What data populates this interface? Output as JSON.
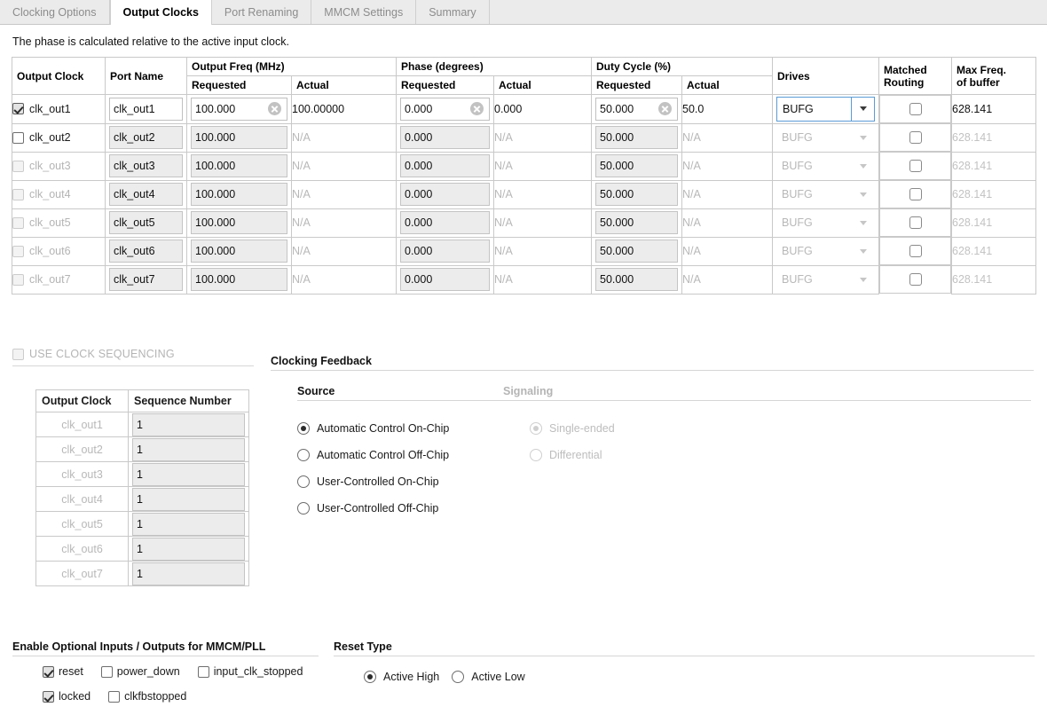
{
  "tabs": [
    {
      "label": "Clocking Options",
      "active": false
    },
    {
      "label": "Output Clocks",
      "active": true
    },
    {
      "label": "Port Renaming",
      "active": false
    },
    {
      "label": "MMCM Settings",
      "active": false
    },
    {
      "label": "Summary",
      "active": false
    }
  ],
  "note": "The phase is calculated relative to the active input clock.",
  "clocks_table": {
    "group_headers": {
      "output_clock": "Output Clock",
      "port_name": "Port Name",
      "output_freq": "Output Freq (MHz)",
      "phase": "Phase (degrees)",
      "duty_cycle": "Duty Cycle (%)",
      "drives": "Drives",
      "matched_routing_line1": "Matched",
      "matched_routing_line2": "Routing",
      "max_freq_line1": "Max Freq.",
      "max_freq_line2": "of buffer"
    },
    "sub_headers": {
      "requested": "Requested",
      "actual": "Actual"
    },
    "na_text": "N/A",
    "rows": [
      {
        "name": "clk_out1",
        "checked": true,
        "enabled": true,
        "port_name": "clk_out1",
        "freq_requested": "100.000",
        "freq_actual": "100.00000",
        "phase_requested": "0.000",
        "phase_actual": "0.000",
        "duty_requested": "50.000",
        "duty_actual": "50.0",
        "drives": "BUFG",
        "matched_routing": false,
        "max_freq": "628.141"
      },
      {
        "name": "clk_out2",
        "checked": false,
        "enabled": true,
        "port_name": "clk_out2",
        "freq_requested": "100.000",
        "freq_actual": "N/A",
        "phase_requested": "0.000",
        "phase_actual": "N/A",
        "duty_requested": "50.000",
        "duty_actual": "N/A",
        "drives": "BUFG",
        "matched_routing": false,
        "max_freq": "628.141"
      },
      {
        "name": "clk_out3",
        "checked": false,
        "enabled": false,
        "port_name": "clk_out3",
        "freq_requested": "100.000",
        "freq_actual": "N/A",
        "phase_requested": "0.000",
        "phase_actual": "N/A",
        "duty_requested": "50.000",
        "duty_actual": "N/A",
        "drives": "BUFG",
        "matched_routing": false,
        "max_freq": "628.141"
      },
      {
        "name": "clk_out4",
        "checked": false,
        "enabled": false,
        "port_name": "clk_out4",
        "freq_requested": "100.000",
        "freq_actual": "N/A",
        "phase_requested": "0.000",
        "phase_actual": "N/A",
        "duty_requested": "50.000",
        "duty_actual": "N/A",
        "drives": "BUFG",
        "matched_routing": false,
        "max_freq": "628.141"
      },
      {
        "name": "clk_out5",
        "checked": false,
        "enabled": false,
        "port_name": "clk_out5",
        "freq_requested": "100.000",
        "freq_actual": "N/A",
        "phase_requested": "0.000",
        "phase_actual": "N/A",
        "duty_requested": "50.000",
        "duty_actual": "N/A",
        "drives": "BUFG",
        "matched_routing": false,
        "max_freq": "628.141"
      },
      {
        "name": "clk_out6",
        "checked": false,
        "enabled": false,
        "port_name": "clk_out6",
        "freq_requested": "100.000",
        "freq_actual": "N/A",
        "phase_requested": "0.000",
        "phase_actual": "N/A",
        "duty_requested": "50.000",
        "duty_actual": "N/A",
        "drives": "BUFG",
        "matched_routing": false,
        "max_freq": "628.141"
      },
      {
        "name": "clk_out7",
        "checked": false,
        "enabled": false,
        "port_name": "clk_out7",
        "freq_requested": "100.000",
        "freq_actual": "N/A",
        "phase_requested": "0.000",
        "phase_actual": "N/A",
        "duty_requested": "50.000",
        "duty_actual": "N/A",
        "drives": "BUFG",
        "matched_routing": false,
        "max_freq": "628.141"
      }
    ]
  },
  "sequencing": {
    "toggle_label": "USE CLOCK SEQUENCING",
    "toggle_checked": false,
    "toggle_enabled": false,
    "headers": {
      "clock": "Output Clock",
      "sequence": "Sequence Number"
    },
    "rows": [
      {
        "clock": "clk_out1",
        "sequence": "1"
      },
      {
        "clock": "clk_out2",
        "sequence": "1"
      },
      {
        "clock": "clk_out3",
        "sequence": "1"
      },
      {
        "clock": "clk_out4",
        "sequence": "1"
      },
      {
        "clock": "clk_out5",
        "sequence": "1"
      },
      {
        "clock": "clk_out6",
        "sequence": "1"
      },
      {
        "clock": "clk_out7",
        "sequence": "1"
      }
    ]
  },
  "clocking_feedback": {
    "title": "Clocking Feedback",
    "source": {
      "title": "Source",
      "options": [
        {
          "label": "Automatic Control On-Chip",
          "selected": true,
          "enabled": true
        },
        {
          "label": "Automatic Control Off-Chip",
          "selected": false,
          "enabled": true
        },
        {
          "label": "User-Controlled On-Chip",
          "selected": false,
          "enabled": true
        },
        {
          "label": "User-Controlled Off-Chip",
          "selected": false,
          "enabled": true
        }
      ]
    },
    "signaling": {
      "title": "Signaling",
      "options": [
        {
          "label": "Single-ended",
          "selected": true,
          "enabled": false
        },
        {
          "label": "Differential",
          "selected": false,
          "enabled": false
        }
      ]
    }
  },
  "optional_io": {
    "title": "Enable Optional Inputs / Outputs for MMCM/PLL",
    "row1": [
      {
        "label": "reset",
        "checked": true
      },
      {
        "label": "power_down",
        "checked": false
      },
      {
        "label": "input_clk_stopped",
        "checked": false
      }
    ],
    "row2": [
      {
        "label": "locked",
        "checked": true
      },
      {
        "label": "clkfbstopped",
        "checked": false
      }
    ]
  },
  "reset_type": {
    "title": "Reset Type",
    "options": [
      {
        "label": "Active High",
        "selected": true
      },
      {
        "label": "Active Low",
        "selected": false
      }
    ]
  },
  "colors": {
    "accent_focus": "#5b9bd5",
    "tabbar_bg": "#ebebeb",
    "border": "#c9c9c9",
    "disabled_text": "#b8b8b8",
    "input_disabled_bg": "#ececec"
  }
}
